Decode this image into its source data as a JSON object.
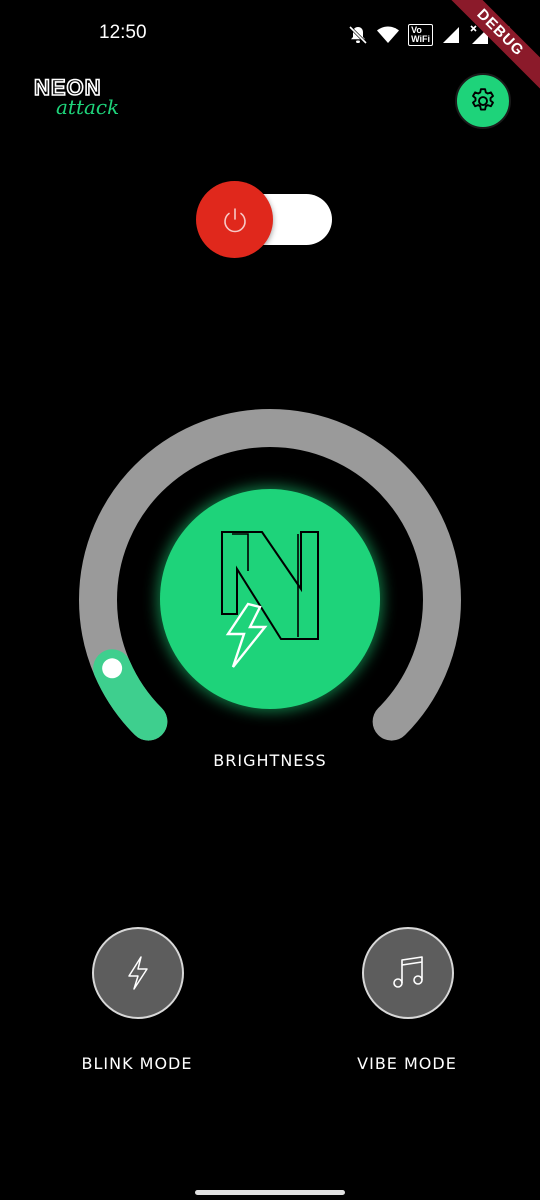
{
  "status_bar": {
    "time": "12:50",
    "icons": [
      "bell-off-icon",
      "wifi-icon",
      "vowifi-icon",
      "signal-icon",
      "signal-x-icon",
      "battery-icon"
    ],
    "vowifi_line1": "Vo",
    "vowifi_line2": "WiFi"
  },
  "debug_banner": "DEBUG",
  "logo": {
    "line1": "NEON",
    "line2": "attack"
  },
  "power_toggle": {
    "state": "off",
    "thumb_color": "#e0281c",
    "track_color": "#ffffff"
  },
  "brightness": {
    "label": "BRIGHTNESS",
    "level": 0.08,
    "active_color": "#3ecf8e",
    "track_color": "#9a9a9a"
  },
  "center_button": {
    "icon": "neon-n-bolt-icon",
    "color": "#1ed37a"
  },
  "modes": [
    {
      "icon": "bolt-icon",
      "label": "BLINK MODE"
    },
    {
      "icon": "music-note-icon",
      "label": "VIBE MODE"
    }
  ],
  "accent_color": "#1ed37a"
}
